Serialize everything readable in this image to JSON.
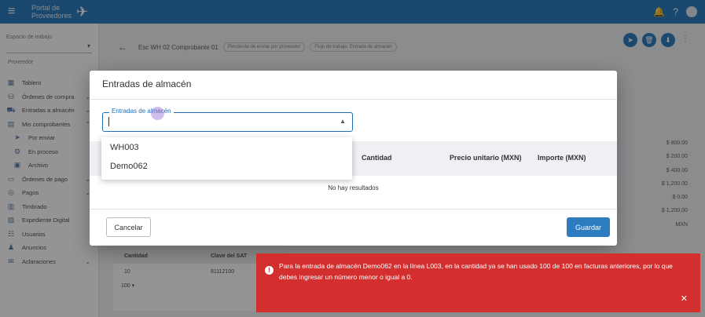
{
  "topbar": {
    "menu_icon": "hamburger-icon",
    "logo_line1": "Portal de",
    "logo_line2": "Proveedores",
    "icons": [
      "bell-icon",
      "help-icon",
      "avatar"
    ]
  },
  "sidebar": {
    "workspace_label": "Espacio de trabajo",
    "provider_label": "Proveedor",
    "items": [
      {
        "label": "Tablero",
        "icon": "dashboard-icon",
        "caret": false
      },
      {
        "label": "Órdenes de compra",
        "icon": "cart-icon",
        "caret": true
      },
      {
        "label": "Entradas a almacén",
        "icon": "truck-icon",
        "caret": true
      },
      {
        "label": "Mis comprobantes",
        "icon": "document-icon",
        "caret": true
      }
    ],
    "sub_items": [
      {
        "label": "Por enviar",
        "icon": "send-icon"
      },
      {
        "label": "En proceso",
        "icon": "process-icon"
      },
      {
        "label": "Archivo",
        "icon": "archive-icon"
      }
    ],
    "items2": [
      {
        "label": "Órdenes de pago",
        "icon": "payment-icon",
        "caret": true
      },
      {
        "label": "Pagos",
        "icon": "coin-icon",
        "caret": true
      },
      {
        "label": "Timbrado",
        "icon": "building-icon",
        "caret": false
      },
      {
        "label": "Expediente Digital",
        "icon": "folder-icon",
        "caret": false
      },
      {
        "label": "Usuarios",
        "icon": "users-icon",
        "caret": false
      },
      {
        "label": "Anuncios",
        "icon": "announce-icon",
        "caret": false
      },
      {
        "label": "Aclaraciones",
        "icon": "mail-icon",
        "caret": true
      }
    ]
  },
  "page": {
    "title": "Esc WH 02 Comprobante 01",
    "chip1": "Pendiente de enviar por proveedor",
    "chip2": "Flujo de trabajo: Entrada de almacén",
    "amounts": [
      "$ 800.00",
      "$ 200.00",
      "$ 400.00",
      "$ 1,200.00",
      "$ 0.00",
      "$ 1,200.00",
      "MXN"
    ],
    "bg_table": {
      "headers": [
        "Cantidad",
        "Clave del SAT"
      ],
      "row": [
        "10",
        "81112100"
      ],
      "pager": "100 ▾"
    }
  },
  "modal": {
    "title": "Entradas de almacén",
    "combo_label": "Entradas de almacén",
    "combo_value": "",
    "columns": [
      "Cantidad",
      "Precio unitario (MXN)",
      "Importe (MXN)"
    ],
    "empty_text": "No hay resultados",
    "cancel_label": "Cancelar",
    "save_label": "Guardar",
    "options": [
      "WH003",
      "Demo062"
    ]
  },
  "toast": {
    "message": "Para la entrada de almacén Demo062 en la línea L003, en la cantidad ya se han usado 100 de 100 en facturas anteriores, por lo que debes ingresar un número menor o igual a 0.",
    "close_icon": "close-icon"
  }
}
